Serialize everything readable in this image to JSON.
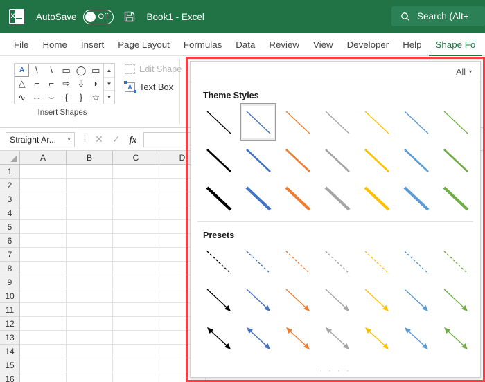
{
  "titlebar": {
    "app_icon": "excel-logo-icon",
    "autosave_label": "AutoSave",
    "autosave_state": "Off",
    "save_icon": "save-disk-icon",
    "document_title": "Book1  -  Excel",
    "search_icon": "search-icon",
    "search_placeholder": "Search (Alt+"
  },
  "ribbon_tabs": [
    {
      "label": "File",
      "active": false
    },
    {
      "label": "Home",
      "active": false
    },
    {
      "label": "Insert",
      "active": false
    },
    {
      "label": "Page Layout",
      "active": false
    },
    {
      "label": "Formulas",
      "active": false
    },
    {
      "label": "Data",
      "active": false
    },
    {
      "label": "Review",
      "active": false
    },
    {
      "label": "View",
      "active": false
    },
    {
      "label": "Developer",
      "active": false
    },
    {
      "label": "Help",
      "active": false
    },
    {
      "label": "Shape Fo",
      "active": true
    }
  ],
  "ribbon": {
    "insert_shapes": {
      "group_label": "Insert Shapes",
      "shape_glyphs": [
        "A",
        "\\",
        "\\",
        "▭",
        "◯",
        "▭",
        "△",
        "⌐",
        "⌐",
        "⇨",
        "⇩",
        "◗",
        "∿",
        "⌢",
        "⌣",
        "{",
        "}",
        "☆"
      ],
      "scroll_up": "▲",
      "scroll_down": "▼",
      "scroll_more": "▾",
      "edit_shape_label": "Edit Shape",
      "edit_shape_caret": "˅",
      "edit_shape_disabled": true,
      "text_box_label": "Text Box",
      "text_box_icon_glyph": "A"
    }
  },
  "formula_bar": {
    "name_box_value": "Straight Ar...",
    "name_box_caret": "˅",
    "cancel_icon": "✕",
    "enter_icon": "✓",
    "function_icon": "fx",
    "formula_value": ""
  },
  "grid": {
    "columns": [
      "A",
      "B",
      "C",
      "D"
    ],
    "rows": [
      1,
      2,
      3,
      4,
      5,
      6,
      7,
      8,
      9,
      10,
      11,
      12,
      13,
      14,
      15,
      16
    ]
  },
  "styles_panel": {
    "border_color": "#f4424b",
    "filter_label": "All",
    "filter_caret": "▾",
    "theme_styles_title": "Theme Styles",
    "presets_title": "Presets",
    "resize_grip": "· · · ·",
    "colors": [
      "#000000",
      "#4472c4",
      "#ed7d31",
      "#a5a5a5",
      "#ffc000",
      "#5b9bd5",
      "#70ad47"
    ],
    "theme_rows": [
      {
        "name": "thin",
        "width": 1.4,
        "selected_index": 1
      },
      {
        "name": "medium",
        "width": 2.6,
        "selected_index": -1
      },
      {
        "name": "thick",
        "width": 4.2,
        "selected_index": -1
      }
    ],
    "preset_rows": [
      {
        "name": "dashed-line",
        "width": 1.4,
        "dashed": true,
        "arrow_end": false,
        "arrow_start": false
      },
      {
        "name": "single-arrow",
        "width": 1.4,
        "dashed": false,
        "arrow_end": true,
        "arrow_start": false
      },
      {
        "name": "double-arrow",
        "width": 1.4,
        "dashed": false,
        "arrow_end": true,
        "arrow_start": true
      }
    ]
  }
}
